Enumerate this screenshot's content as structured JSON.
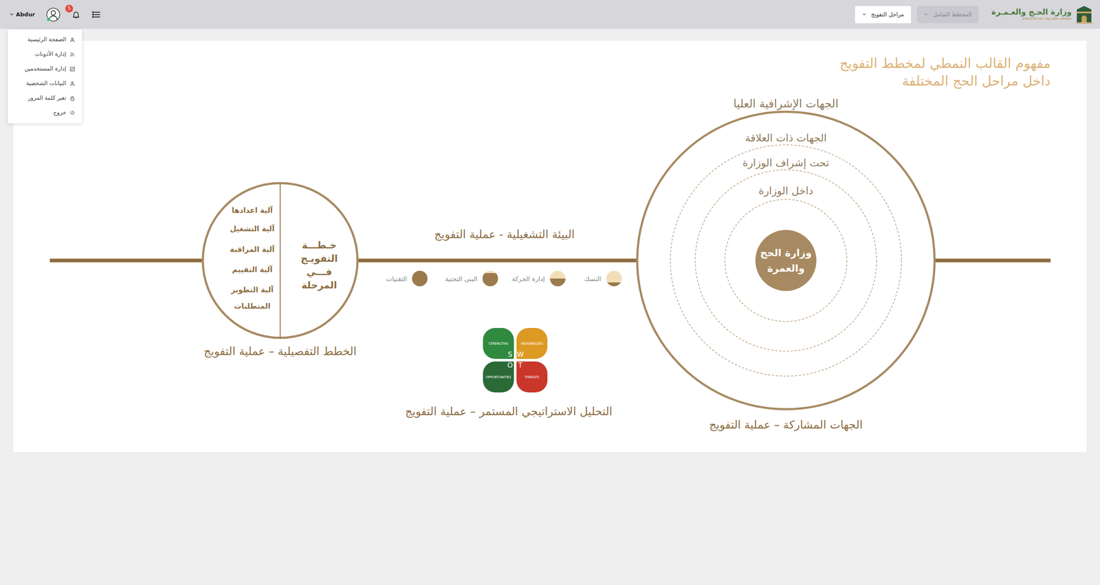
{
  "navbar": {
    "logo": {
      "title": "وزارة الحـج والعـمـرة",
      "subtitle": "MINISTRY OF HAJJ AND UMRAH"
    },
    "dropdowns": [
      {
        "label": "مراحل التفويج",
        "disabled": false
      },
      {
        "label": "المخطط الشامل",
        "disabled": true
      }
    ],
    "notifications": {
      "count": "5"
    },
    "user": {
      "name": "Abdur",
      "online": true,
      "menu_open": true
    }
  },
  "user_menu": [
    {
      "label": "الصفحة الرئيسية"
    },
    {
      "label": "إدارة الأذونات"
    },
    {
      "label": "إدارة المستخدمين"
    },
    {
      "label": "البيانات الشخصية"
    },
    {
      "label": "تغير كلمة المرور"
    },
    {
      "label": "خروج"
    }
  ],
  "diagram": {
    "title": [
      "مفهوم القالب النمطي لمخطط التفويج",
      "داخل مراحل الحج المختلفة"
    ],
    "stakeholders": {
      "rings": [
        "الجهات الإشرافية العليا",
        "الجهات ذات العلاقة",
        "تحت إشراف الوزارة",
        "داخل الوزارة"
      ],
      "center": [
        "وزارة الحج",
        "والعمرة"
      ],
      "caption": "الجهات المشاركة – عملية التفويج"
    },
    "environment": {
      "title": "البيئة التشغيلية - عملية التفويج",
      "factors": [
        {
          "label": "النسك",
          "level": 0.25
        },
        {
          "label": "إدارة الحركة",
          "level": 0.5
        },
        {
          "label": "البنى التحتية",
          "level": 0.85
        },
        {
          "label": "التقنيات",
          "level": 1
        }
      ]
    },
    "swot": {
      "quadrants": [
        {
          "letter": "S",
          "label": "STRENGTHS",
          "color": "#2f8a3f"
        },
        {
          "letter": "W",
          "label": "WEAKNESSES",
          "color": "#dc9a24"
        },
        {
          "letter": "O",
          "label": "OPPORTUNITIES",
          "color": "#2b6a37"
        },
        {
          "letter": "T",
          "label": "THREATS",
          "color": "#c9362a"
        }
      ],
      "caption": "التحليل الاستراتيجي المستمر – عملية التفويج"
    },
    "plan": {
      "title": [
        "خـطـــة",
        "التفويـج",
        "فـــي",
        "المرحلة"
      ],
      "items": [
        "آلية اعدادها",
        "آلية التشغيل",
        "آلية المراقبة",
        "آلية التقييم",
        "آلية التطوير",
        "المتطلبات"
      ],
      "caption": "الخطط التفصيلية – عملية التفويج"
    }
  }
}
